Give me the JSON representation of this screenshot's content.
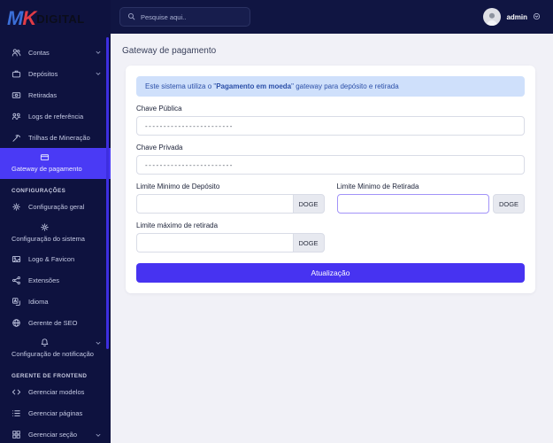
{
  "logo": {
    "part1": "M",
    "part2": "K",
    "part3": "DIGITAL"
  },
  "header": {
    "search_placeholder": "Pesquise aqui..",
    "search_icon": "search-icon",
    "username": "admin"
  },
  "sidebar": {
    "sections": [
      {
        "items": [
          {
            "label": "Contas",
            "icon": "users-icon",
            "chevron": true
          },
          {
            "label": "Depósitos",
            "icon": "briefcase-icon",
            "chevron": true
          },
          {
            "label": "Retiradas",
            "icon": "cash-icon"
          },
          {
            "label": "Logs de referência",
            "icon": "referral-icon"
          },
          {
            "label": "Trilhas de Mineração",
            "icon": "pickaxe-icon"
          },
          {
            "label": "Gateway de pagamento",
            "icon": "credit-card-icon",
            "active": true
          }
        ]
      },
      {
        "header": "CONFIGURAÇÕES",
        "items": [
          {
            "label": "Configuração geral",
            "icon": "gear-icon"
          },
          {
            "label": "Configuração do sistema",
            "icon": "gear-icon"
          },
          {
            "label": "Logo & Favicon",
            "icon": "image-icon"
          },
          {
            "label": "Extensões",
            "icon": "share-nodes-icon"
          },
          {
            "label": "Idioma",
            "icon": "language-icon"
          },
          {
            "label": "Gerente de SEO",
            "icon": "globe-icon"
          },
          {
            "label": "Configuração de notificação",
            "icon": "bell-icon",
            "chevron": true
          }
        ]
      },
      {
        "header": "GERENTE DE FRONTEND",
        "items": [
          {
            "label": "Gerenciar modelos",
            "icon": "code-icon"
          },
          {
            "label": "Gerenciar páginas",
            "icon": "list-icon"
          },
          {
            "label": "Gerenciar seção",
            "icon": "grid-icon",
            "chevron": true
          }
        ]
      }
    ]
  },
  "page": {
    "title": "Gateway de pagamento",
    "alert": {
      "prefix": "Este sistema utiliza o \"",
      "bold": "Pagamento em moeda",
      "suffix": "\" gateway para depósito e retirada"
    },
    "fields": {
      "public_key_label": "Chave Pública",
      "public_key_value": "------------------------",
      "private_key_label": "Chave Privada",
      "private_key_value": "------------------------",
      "min_deposit_label": "Limite Minimo de Depósito",
      "min_deposit_value": "",
      "min_withdraw_label": "Limite Minimo de Retirada",
      "min_withdraw_value": "",
      "max_withdraw_label": "Limite máximo de retirada",
      "max_withdraw_value": "",
      "currency": "DOGE"
    },
    "submit_label": "Atualização"
  },
  "colors": {
    "accent": "#4733f1",
    "sidebar_bg": "#0e123f",
    "topbar_bg": "#101542",
    "active_item_bg": "#4a3af5",
    "alert_bg": "#cfe0fb",
    "alert_text": "#2b4fa8",
    "main_bg": "#f1f1f7",
    "focused_border": "#a293f8"
  }
}
